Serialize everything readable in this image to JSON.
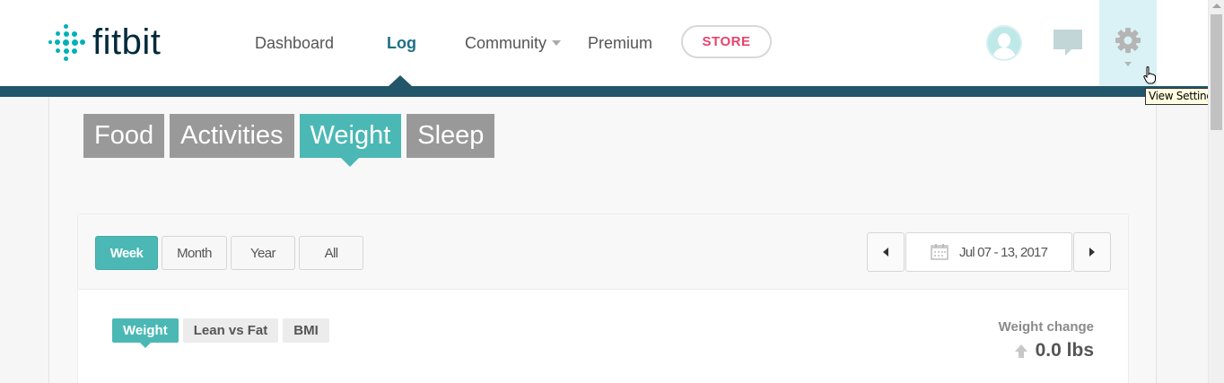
{
  "header": {
    "logo_text": "fitbit",
    "nav": {
      "dashboard": "Dashboard",
      "log": "Log",
      "community": "Community",
      "premium": "Premium"
    },
    "store_label": "STORE",
    "icons": [
      "fitbit-logo-icon",
      "avatar-icon",
      "messages-icon",
      "gear-icon",
      "chevron-down-icon",
      "hand-cursor-icon"
    ],
    "tooltip": "View Settings"
  },
  "category_tabs": [
    {
      "label": "Food"
    },
    {
      "label": "Activities"
    },
    {
      "label": "Weight",
      "active": true
    },
    {
      "label": "Sleep"
    }
  ],
  "range_buttons": [
    {
      "label": "Week",
      "active": true
    },
    {
      "label": "Month"
    },
    {
      "label": "Year"
    },
    {
      "label": "All"
    }
  ],
  "date_range": "Jul 07 - 13, 2017",
  "sub_tabs": [
    {
      "label": "Weight",
      "active": true
    },
    {
      "label": "Lean vs Fat"
    },
    {
      "label": "BMI"
    }
  ],
  "weight_change": {
    "label": "Weight change",
    "value": "0.0 lbs"
  },
  "colors": {
    "accent": "#4bb8b5",
    "nav_bar": "#22566a",
    "active_nav": "#1f6e86",
    "store": "#e8436c",
    "inactive_tab": "#999999"
  }
}
